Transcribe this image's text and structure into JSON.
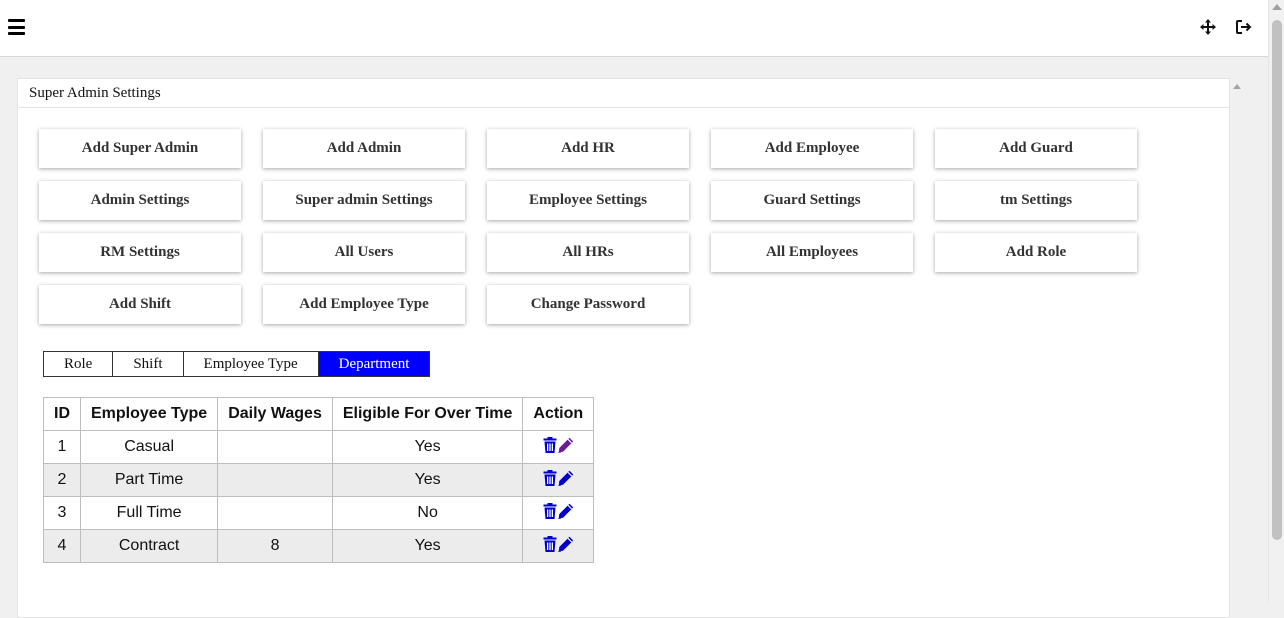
{
  "panel": {
    "title": "Super Admin Settings"
  },
  "buttons": [
    "Add Super Admin",
    "Add Admin",
    "Add HR",
    "Add Employee",
    "Add Guard",
    "Admin Settings",
    "Super admin Settings",
    "Employee Settings",
    "Guard Settings",
    "tm Settings",
    "RM Settings",
    "All Users",
    "All HRs",
    "All Employees",
    "Add Role",
    "Add Shift",
    "Add Employee Type",
    "Change Password"
  ],
  "tabs": [
    {
      "label": "Role",
      "active": false
    },
    {
      "label": "Shift",
      "active": false
    },
    {
      "label": "Employee Type",
      "active": false
    },
    {
      "label": "Department",
      "active": true
    }
  ],
  "table": {
    "headers": [
      "ID",
      "Employee Type",
      "Daily Wages",
      "Eligible For Over Time",
      "Action"
    ],
    "rows": [
      {
        "id": "1",
        "type": "Casual",
        "wages": "",
        "overtime": "Yes"
      },
      {
        "id": "2",
        "type": "Part Time",
        "wages": "",
        "overtime": "Yes"
      },
      {
        "id": "3",
        "type": "Full Time",
        "wages": "",
        "overtime": "No"
      },
      {
        "id": "4",
        "type": "Contract",
        "wages": "8",
        "overtime": "Yes"
      }
    ]
  },
  "icons": {
    "menu": "hamburger-icon",
    "move": "move-arrows-icon",
    "logout": "logout-icon",
    "delete": "trash-icon",
    "edit": "pencil-icon"
  },
  "colors": {
    "active_tab": "#0000ff",
    "action_icon": "#0000cc",
    "edit_icon_first_row": "#6a1b9a"
  }
}
